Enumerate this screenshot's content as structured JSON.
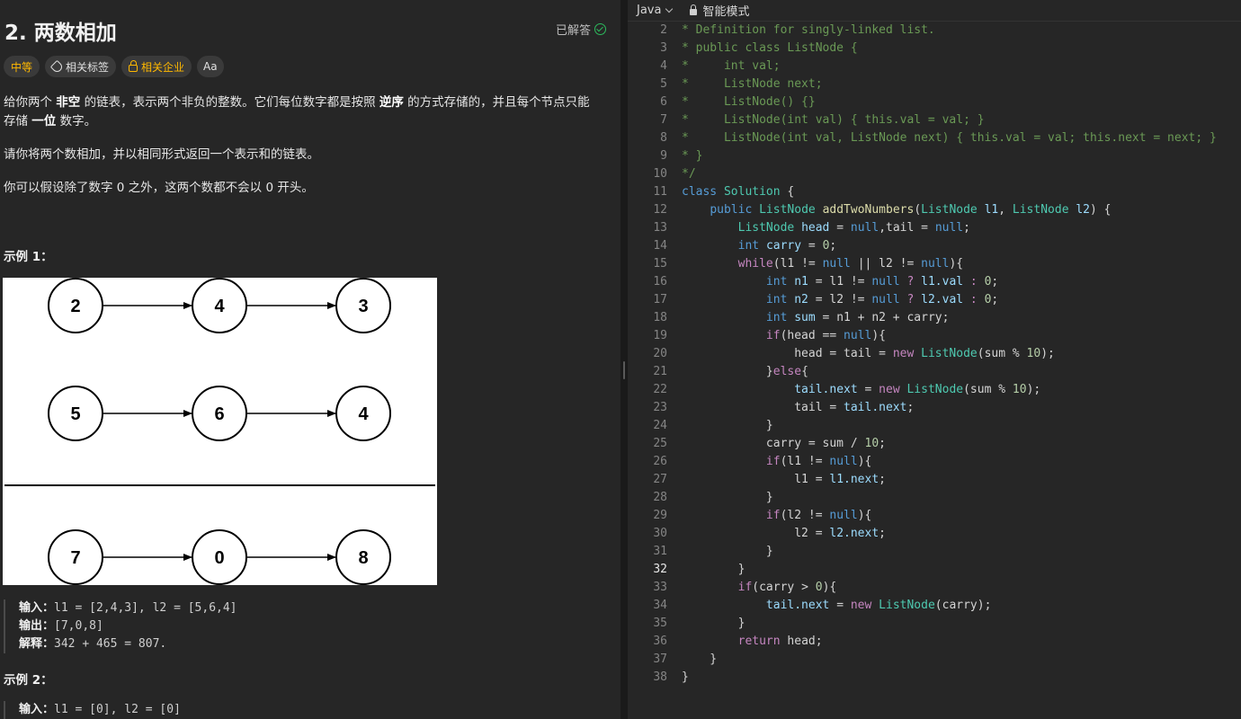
{
  "problem": {
    "title": "2. 两数相加",
    "status": "已解答",
    "tags": {
      "difficulty": "中等",
      "related_tags": "相关标签",
      "related_companies": "相关企业",
      "font_size": "Aa"
    },
    "description": {
      "p1_a": "给你两个 ",
      "p1_b": "非空",
      "p1_c": " 的链表，表示两个非负的整数。它们每位数字都是按照 ",
      "p1_d": "逆序",
      "p1_e": " 的方式存储的，并且每个节点只能存储 ",
      "p1_f": "一位",
      "p1_g": " 数字。",
      "p2": "请你将两个数相加，并以相同形式返回一个表示和的链表。",
      "p3": "你可以假设除了数字 0 之外，这两个数都不会以 0 开头。"
    },
    "example1": {
      "title": "示例 1：",
      "diagram": {
        "row1": [
          "2",
          "4",
          "3"
        ],
        "row2": [
          "5",
          "6",
          "4"
        ],
        "row3": [
          "7",
          "0",
          "8"
        ]
      },
      "input_label": "输入：",
      "input": "l1 = [2,4,3], l2 = [5,6,4]",
      "output_label": "输出：",
      "output": "[7,0,8]",
      "explain_label": "解释：",
      "explain": "342 + 465 = 807."
    },
    "example2": {
      "title": "示例 2：",
      "input_label": "输入：",
      "input": "l1 = [0], l2 = [0]"
    }
  },
  "editor": {
    "language": "Java",
    "mode": "智能模式",
    "active_line": 32,
    "lines": [
      {
        "n": 2,
        "tokens": [
          [
            "c",
            "* Definition for singly-linked list."
          ]
        ]
      },
      {
        "n": 3,
        "tokens": [
          [
            "c",
            "* public class ListNode {"
          ]
        ]
      },
      {
        "n": 4,
        "tokens": [
          [
            "c",
            "*     int val;"
          ]
        ]
      },
      {
        "n": 5,
        "tokens": [
          [
            "c",
            "*     ListNode next;"
          ]
        ]
      },
      {
        "n": 6,
        "tokens": [
          [
            "c",
            "*     ListNode() {}"
          ]
        ]
      },
      {
        "n": 7,
        "tokens": [
          [
            "c",
            "*     ListNode(int val) { this.val = val; }"
          ]
        ]
      },
      {
        "n": 8,
        "tokens": [
          [
            "c",
            "*     ListNode(int val, ListNode next) { this.val = val; this.next = next; }"
          ]
        ]
      },
      {
        "n": 9,
        "tokens": [
          [
            "c",
            "* }"
          ]
        ]
      },
      {
        "n": 10,
        "tokens": [
          [
            "c",
            "*/"
          ]
        ]
      },
      {
        "n": 11,
        "tokens": [
          [
            "n",
            "class "
          ],
          [
            "t",
            "Solution"
          ],
          [
            "p",
            " {"
          ]
        ]
      },
      {
        "n": 12,
        "tokens": [
          [
            "p",
            "    "
          ],
          [
            "n",
            "public "
          ],
          [
            "t",
            "ListNode "
          ],
          [
            "f",
            "addTwoNumbers"
          ],
          [
            "p",
            "("
          ],
          [
            "t",
            "ListNode "
          ],
          [
            "v",
            "l1"
          ],
          [
            "p",
            ", "
          ],
          [
            "t",
            "ListNode "
          ],
          [
            "v",
            "l2"
          ],
          [
            "p",
            ") {"
          ]
        ]
      },
      {
        "n": 13,
        "tokens": [
          [
            "p",
            "        "
          ],
          [
            "t",
            "ListNode "
          ],
          [
            "v",
            "head"
          ],
          [
            "p",
            " = "
          ],
          [
            "n",
            "null"
          ],
          [
            "p",
            ",tail = "
          ],
          [
            "n",
            "null"
          ],
          [
            "p",
            ";"
          ]
        ]
      },
      {
        "n": 14,
        "tokens": [
          [
            "p",
            "        "
          ],
          [
            "n",
            "int "
          ],
          [
            "v",
            "carry"
          ],
          [
            "p",
            " = "
          ],
          [
            "num",
            "0"
          ],
          [
            "p",
            ";"
          ]
        ]
      },
      {
        "n": 15,
        "tokens": [
          [
            "p",
            "        "
          ],
          [
            "k",
            "while"
          ],
          [
            "p",
            "(l1 != "
          ],
          [
            "n",
            "null"
          ],
          [
            "p",
            " || l2 != "
          ],
          [
            "n",
            "null"
          ],
          [
            "p",
            "){"
          ]
        ]
      },
      {
        "n": 16,
        "tokens": [
          [
            "p",
            "            "
          ],
          [
            "n",
            "int "
          ],
          [
            "v",
            "n1"
          ],
          [
            "p",
            " = l1 != "
          ],
          [
            "n",
            "null"
          ],
          [
            "k",
            " ? "
          ],
          [
            "v",
            "l1.val"
          ],
          [
            "k",
            " : "
          ],
          [
            "num",
            "0"
          ],
          [
            "p",
            ";"
          ]
        ]
      },
      {
        "n": 17,
        "tokens": [
          [
            "p",
            "            "
          ],
          [
            "n",
            "int "
          ],
          [
            "v",
            "n2"
          ],
          [
            "p",
            " = l2 != "
          ],
          [
            "n",
            "null"
          ],
          [
            "k",
            " ? "
          ],
          [
            "v",
            "l2.val"
          ],
          [
            "k",
            " : "
          ],
          [
            "num",
            "0"
          ],
          [
            "p",
            ";"
          ]
        ]
      },
      {
        "n": 18,
        "tokens": [
          [
            "p",
            "            "
          ],
          [
            "n",
            "int "
          ],
          [
            "v",
            "sum"
          ],
          [
            "p",
            " = n1 + n2 + carry;"
          ]
        ]
      },
      {
        "n": 19,
        "tokens": [
          [
            "p",
            "            "
          ],
          [
            "k",
            "if"
          ],
          [
            "p",
            "(head == "
          ],
          [
            "n",
            "null"
          ],
          [
            "p",
            "){"
          ]
        ]
      },
      {
        "n": 20,
        "tokens": [
          [
            "p",
            "                head = tail = "
          ],
          [
            "k",
            "new "
          ],
          [
            "t",
            "ListNode"
          ],
          [
            "p",
            "(sum % "
          ],
          [
            "num",
            "10"
          ],
          [
            "p",
            ");"
          ]
        ]
      },
      {
        "n": 21,
        "tokens": [
          [
            "p",
            "            }"
          ],
          [
            "k",
            "else"
          ],
          [
            "p",
            "{"
          ]
        ]
      },
      {
        "n": 22,
        "tokens": [
          [
            "p",
            "                "
          ],
          [
            "v",
            "tail.next"
          ],
          [
            "p",
            " = "
          ],
          [
            "k",
            "new "
          ],
          [
            "t",
            "ListNode"
          ],
          [
            "p",
            "(sum % "
          ],
          [
            "num",
            "10"
          ],
          [
            "p",
            ");"
          ]
        ]
      },
      {
        "n": 23,
        "tokens": [
          [
            "p",
            "                tail = "
          ],
          [
            "v",
            "tail.next"
          ],
          [
            "p",
            ";"
          ]
        ]
      },
      {
        "n": 24,
        "tokens": [
          [
            "p",
            "            }"
          ]
        ]
      },
      {
        "n": 25,
        "tokens": [
          [
            "p",
            "            carry = sum / "
          ],
          [
            "num",
            "10"
          ],
          [
            "p",
            ";"
          ]
        ]
      },
      {
        "n": 26,
        "tokens": [
          [
            "p",
            "            "
          ],
          [
            "k",
            "if"
          ],
          [
            "p",
            "(l1 != "
          ],
          [
            "n",
            "null"
          ],
          [
            "p",
            "){"
          ]
        ]
      },
      {
        "n": 27,
        "tokens": [
          [
            "p",
            "                l1 = "
          ],
          [
            "v",
            "l1.next"
          ],
          [
            "p",
            ";"
          ]
        ]
      },
      {
        "n": 28,
        "tokens": [
          [
            "p",
            "            }"
          ]
        ]
      },
      {
        "n": 29,
        "tokens": [
          [
            "p",
            "            "
          ],
          [
            "k",
            "if"
          ],
          [
            "p",
            "(l2 != "
          ],
          [
            "n",
            "null"
          ],
          [
            "p",
            "){"
          ]
        ]
      },
      {
        "n": 30,
        "tokens": [
          [
            "p",
            "                l2 = "
          ],
          [
            "v",
            "l2.next"
          ],
          [
            "p",
            ";"
          ]
        ]
      },
      {
        "n": 31,
        "tokens": [
          [
            "p",
            "            }"
          ]
        ]
      },
      {
        "n": 32,
        "tokens": [
          [
            "p",
            "        }"
          ]
        ]
      },
      {
        "n": 33,
        "tokens": [
          [
            "p",
            "        "
          ],
          [
            "k",
            "if"
          ],
          [
            "p",
            "(carry > "
          ],
          [
            "num",
            "0"
          ],
          [
            "p",
            "){"
          ]
        ]
      },
      {
        "n": 34,
        "tokens": [
          [
            "p",
            "            "
          ],
          [
            "v",
            "tail.next"
          ],
          [
            "p",
            " = "
          ],
          [
            "k",
            "new "
          ],
          [
            "t",
            "ListNode"
          ],
          [
            "p",
            "(carry);"
          ]
        ]
      },
      {
        "n": 35,
        "tokens": [
          [
            "p",
            "        }"
          ]
        ]
      },
      {
        "n": 36,
        "tokens": [
          [
            "p",
            "        "
          ],
          [
            "k",
            "return "
          ],
          [
            "p",
            "head;"
          ]
        ]
      },
      {
        "n": 37,
        "tokens": [
          [
            "p",
            "    }"
          ]
        ]
      },
      {
        "n": 38,
        "tokens": [
          [
            "p",
            "}"
          ]
        ]
      }
    ]
  }
}
